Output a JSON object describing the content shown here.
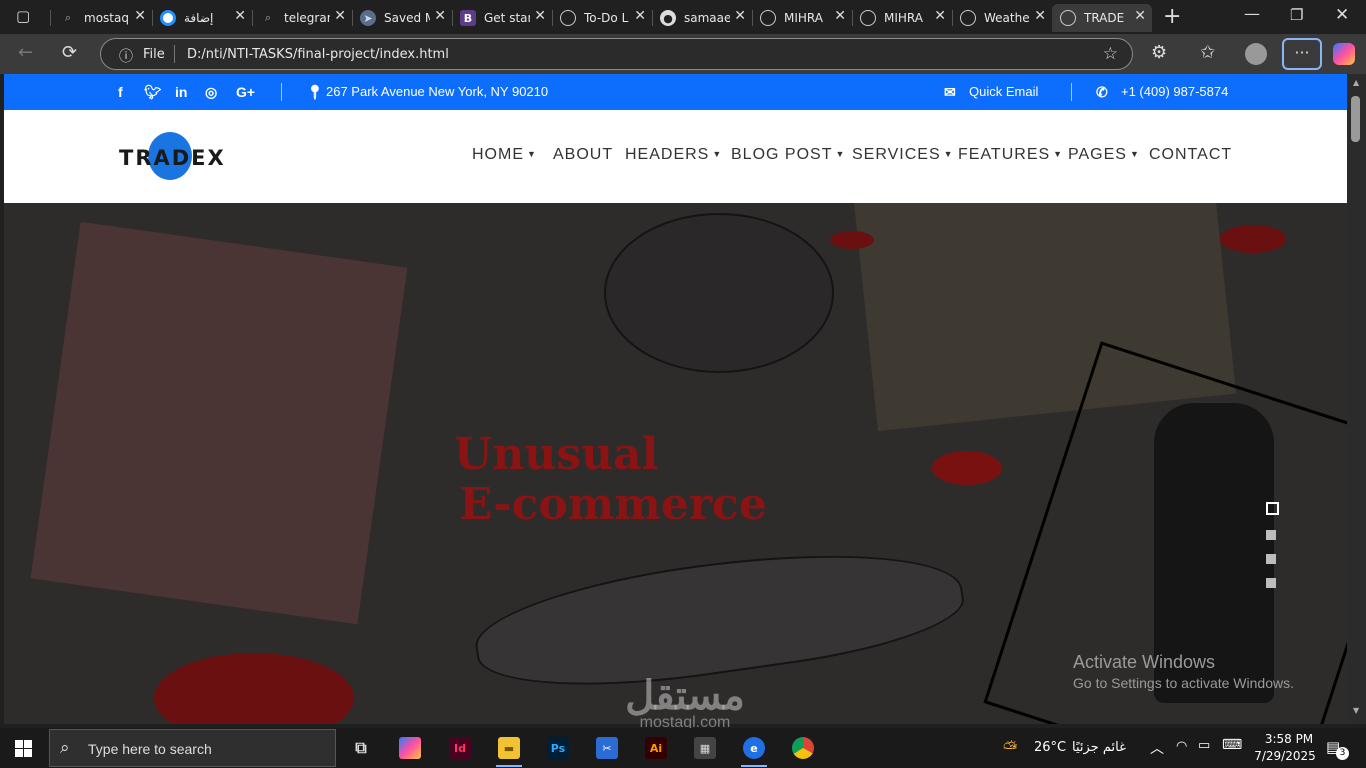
{
  "tabs": [
    {
      "label": "mostaq",
      "icon": "search-icon"
    },
    {
      "label": "إضافة",
      "icon": "circle-icon"
    },
    {
      "label": "telegram",
      "icon": "search-icon"
    },
    {
      "label": "Saved M",
      "icon": "telegram-icon"
    },
    {
      "label": "Get star",
      "icon": "bootstrap-icon"
    },
    {
      "label": "To-Do L",
      "icon": "globe-icon"
    },
    {
      "label": "samaae",
      "icon": "github-icon"
    },
    {
      "label": "MIHRA",
      "icon": "globe-icon"
    },
    {
      "label": "MIHRA",
      "icon": "globe-icon"
    },
    {
      "label": "Weathe",
      "icon": "globe-icon"
    },
    {
      "label": "TRADE",
      "icon": "globe-icon"
    }
  ],
  "address": {
    "scheme_label": "File",
    "url": "D:/nti/NTI-TASKS/final-project/index.html"
  },
  "site": {
    "topbar": {
      "address": "267 Park Avenue New York, NY 90210",
      "email_label": "Quick Email",
      "phone": "+1 (409) 987-5874"
    },
    "logo_text": "TRADEX",
    "nav": [
      {
        "label": "HOME",
        "dropdown": true
      },
      {
        "label": "ABOUT",
        "dropdown": false
      },
      {
        "label": "HEADERS",
        "dropdown": true
      },
      {
        "label": "BLOG POST",
        "dropdown": true
      },
      {
        "label": "SERVICES",
        "dropdown": true
      },
      {
        "label": "FEATURES",
        "dropdown": true
      },
      {
        "label": "PAGES",
        "dropdown": true
      },
      {
        "label": "CONTACT",
        "dropdown": false
      }
    ],
    "hero": {
      "line1": "Unusual",
      "line2": "E-commerce",
      "slides": 4,
      "active_slide": 1
    }
  },
  "watermark": {
    "line1": "Activate Windows",
    "line2": "Go to Settings to activate Windows."
  },
  "overlay_logo": "mostaql.com",
  "taskbar": {
    "search_placeholder": "Type here to search",
    "weather": "26°C",
    "weather_text": "غائم جزئيًا",
    "time": "3:58 PM",
    "date": "7/29/2025",
    "notifications": "3"
  },
  "colors": {
    "brand_blue": "#0d6efd",
    "hero_red": "#8a1313"
  }
}
